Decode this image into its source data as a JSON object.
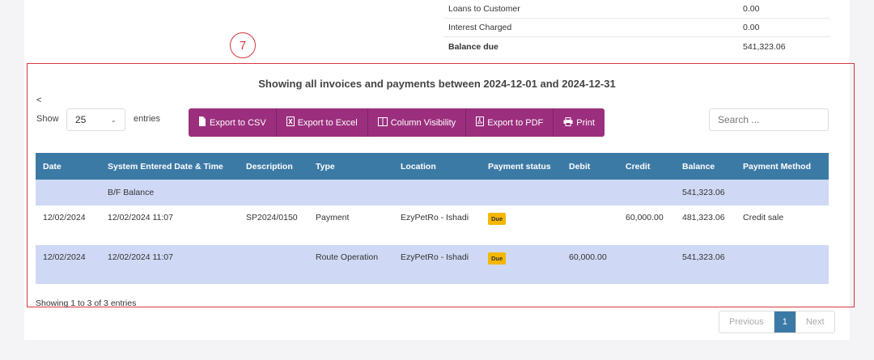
{
  "summary": {
    "rows": [
      {
        "label": "Loans to Customer",
        "value": "0.00"
      },
      {
        "label": "Interest Charged",
        "value": "0.00"
      },
      {
        "label": "Balance due",
        "value": "541,323.06"
      }
    ]
  },
  "annotation": {
    "marker": "7",
    "color": "#d9363e"
  },
  "report": {
    "title": "Showing all invoices and payments between 2024-12-01 and 2024-12-31",
    "back": "<"
  },
  "length": {
    "show_label": "Show",
    "value": "25",
    "entries_label": "entries"
  },
  "buttons": {
    "csv": "Export to CSV",
    "excel": "Export to Excel",
    "columns": "Column Visibility",
    "pdf": "Export to PDF",
    "print": "Print",
    "color": "#9b2f7e"
  },
  "search": {
    "placeholder": "Search ..."
  },
  "table": {
    "header_color": "#3c7aa6",
    "columns": [
      "Date",
      "System Entered Date & Time",
      "Description",
      "Type",
      "Location",
      "Payment status",
      "Debit",
      "Credit",
      "Balance",
      "Payment Method"
    ],
    "rows": [
      {
        "date": "",
        "system": "B/F Balance",
        "description": "",
        "type": "",
        "location": "",
        "status": "",
        "debit": "",
        "credit": "",
        "balance": "541,323.06",
        "method": ""
      },
      {
        "date": "12/02/2024",
        "system": "12/02/2024 11:07",
        "description": "SP2024/0150",
        "type": "Payment",
        "location": "EzyPetRo - Ishadi",
        "status": "Due",
        "debit": "",
        "credit": "60,000.00",
        "balance": "481,323.06",
        "method": "Credit sale"
      },
      {
        "date": "12/02/2024",
        "system": "12/02/2024 11:07",
        "description": "",
        "type": "Route Operation",
        "location": "EzyPetRo - Ishadi",
        "status": "Due",
        "debit": "60,000.00",
        "credit": "",
        "balance": "541,323.06",
        "method": ""
      }
    ]
  },
  "info": "Showing 1 to 3 of 3 entries",
  "pager": {
    "previous": "Previous",
    "current": "1",
    "next": "Next"
  }
}
